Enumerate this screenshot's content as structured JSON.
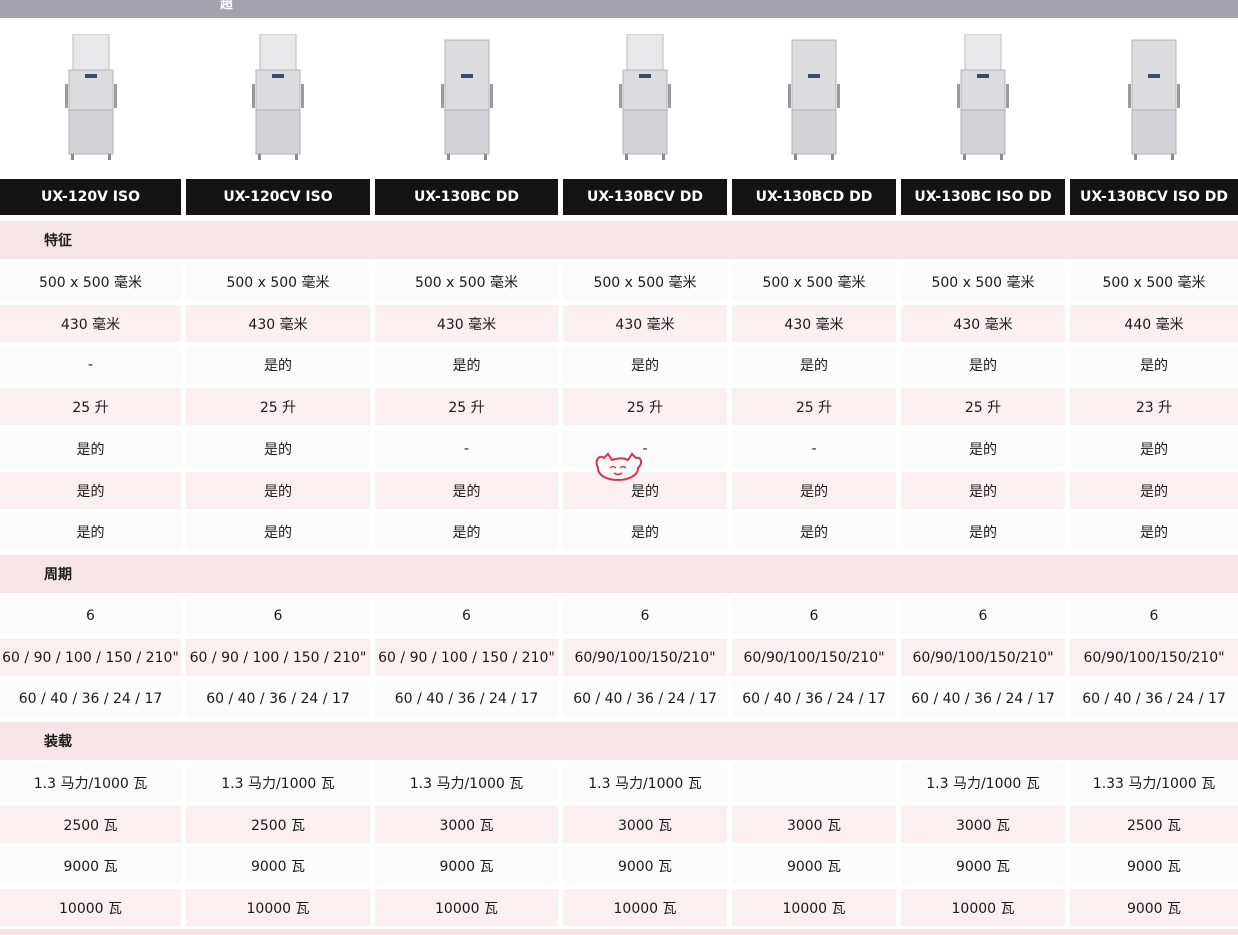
{
  "header": {
    "title": "超"
  },
  "products": [
    {
      "name": "UX-120V ISO",
      "image_icon": "dishwasher-image"
    },
    {
      "name": "UX-120CV ISO",
      "image_icon": "dishwasher-image"
    },
    {
      "name": "UX-130BC DD",
      "image_icon": "dishwasher-image"
    },
    {
      "name": "UX-130BCV DD",
      "image_icon": "dishwasher-image"
    },
    {
      "name": "UX-130BCD DD",
      "image_icon": "dishwasher-image"
    },
    {
      "name": "UX-130BC ISO DD",
      "image_icon": "dishwasher-image"
    },
    {
      "name": "UX-130BCV ISO DD",
      "image_icon": "dishwasher-image"
    }
  ],
  "sections": [
    {
      "label": "特征",
      "rows": [
        [
          "500 x 500 毫米",
          "500 x 500 毫米",
          "500 x 500 毫米",
          "500 x 500 毫米",
          "500 x 500 毫米",
          "500 x 500 毫米",
          "500 x 500 毫米"
        ],
        [
          "430 毫米",
          "430 毫米",
          "430 毫米",
          "430 毫米",
          "430 毫米",
          "430 毫米",
          "440 毫米"
        ],
        [
          "-",
          "是的",
          "是的",
          "是的",
          "是的",
          "是的",
          "是的"
        ],
        [
          "25 升",
          "25 升",
          "25 升",
          "25 升",
          "25 升",
          "25 升",
          "23 升"
        ],
        [
          "是的",
          "是的",
          "-",
          "-",
          "-",
          "是的",
          "是的"
        ],
        [
          "是的",
          "是的",
          "是的",
          "是的",
          "是的",
          "是的",
          "是的"
        ],
        [
          "是的",
          "是的",
          "是的",
          "是的",
          "是的",
          "是的",
          "是的"
        ]
      ]
    },
    {
      "label": "周期",
      "rows": [
        [
          "6",
          "6",
          "6",
          "6",
          "6",
          "6",
          "6"
        ],
        [
          "60 / 90 / 100 / 150 / 210\"",
          "60 / 90 / 100 / 150 / 210\"",
          "60 / 90 / 100 / 150 / 210\"",
          "60/90/100/150/210\"",
          "60/90/100/150/210\"",
          "60/90/100/150/210\"",
          "60/90/100/150/210\""
        ],
        [
          "60 / 40 / 36 / 24 / 17",
          "60 / 40 / 36 / 24 / 17",
          "60 / 40 / 36 / 24 / 17",
          "60 / 40 / 36 / 24 / 17",
          "60 / 40 / 36 / 24 / 17",
          "60 / 40 / 36 / 24 / 17",
          "60 / 40 / 36 / 24 / 17"
        ]
      ]
    },
    {
      "label": "装载",
      "rows": [
        [
          "1.3 马力/1000 瓦",
          "1.3 马力/1000 瓦",
          "1.3 马力/1000 瓦",
          "1.3 马力/1000 瓦",
          "",
          "1.3 马力/1000 瓦",
          "1.33 马力/1000 瓦"
        ],
        [
          "2500 瓦",
          "2500 瓦",
          "3000 瓦",
          "3000 瓦",
          "3000 瓦",
          "3000 瓦",
          "2500 瓦"
        ],
        [
          "9000 瓦",
          "9000 瓦",
          "9000 瓦",
          "9000 瓦",
          "9000 瓦",
          "9000 瓦",
          "9000 瓦"
        ],
        [
          "10000 瓦",
          "10000 瓦",
          "10000 瓦",
          "10000 瓦",
          "10000 瓦",
          "10000 瓦",
          "9000 瓦"
        ]
      ]
    }
  ],
  "watermark": {
    "icon": "cat-mascot-icon",
    "color": "#d4354f"
  }
}
